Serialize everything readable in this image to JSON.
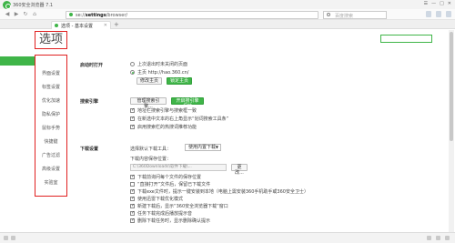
{
  "window": {
    "title": "360安全浏览器 7.1"
  },
  "titlebar_controls": [
    "☰",
    "—",
    "□",
    "✕"
  ],
  "nav": {
    "back_glyph": "◀",
    "forward_glyph": "▶",
    "refresh_glyph": "↻",
    "home_glyph": "⌂",
    "url_prefix": "se://",
    "url_bold": "settings",
    "url_suffix": "/browser/",
    "search_placeholder": "百度搜索"
  },
  "tab": {
    "label": "选项 - 基本设置",
    "close": "✕",
    "add": "+"
  },
  "page": {
    "title": "选项"
  },
  "sidebar": {
    "items": [
      {
        "label": "基本设置",
        "active": true
      },
      {
        "label": "界面设置"
      },
      {
        "label": "标签设置"
      },
      {
        "label": "优化加速"
      },
      {
        "label": "隐私保护"
      },
      {
        "label": "鼠标手势"
      },
      {
        "label": "快捷键"
      },
      {
        "label": "广告过滤"
      },
      {
        "label": "高级设置"
      },
      {
        "label": "实验室"
      }
    ]
  },
  "startup": {
    "label": "启动时打开",
    "option1": "上次退出时未关闭的页面",
    "option2": "主页  http://hao.360.cn/",
    "change_home": "修改主页",
    "lock_home": "锁定主页"
  },
  "search_engine": {
    "label": "搜索引擎",
    "manage": "管理搜索引擎...",
    "protect": "开启搜引擎保护",
    "opt1": "地址栏搜索引擎与搜索框一致",
    "opt2": "在新选中文本的右上角显示“划词搜索工具条”",
    "opt3": "启用搜索栏的热搜词推荐功能"
  },
  "download": {
    "label": "下载设置",
    "tool_label": "选择默认下载工具：",
    "tool_value": "使用内置下载",
    "path_label": "下载内容保存位置：",
    "path_value": "C:\\360Downloads\\软件下载\\...",
    "change": "更改...",
    "opts": [
      "下载前询问每个文件的保存位置",
      "“直接打开”文件后，保留已下载文件",
      "下载exe文件时，提示一键安装到本地（电脑上需安装360手机助手或360安全卫士）",
      "使用迅雷下载优化模式",
      "新建下载后，显示“360安全浏览器下载”窗口",
      "任务下载完成后播放提示音",
      "删除下载任务时，显示删除确认提示"
    ]
  }
}
